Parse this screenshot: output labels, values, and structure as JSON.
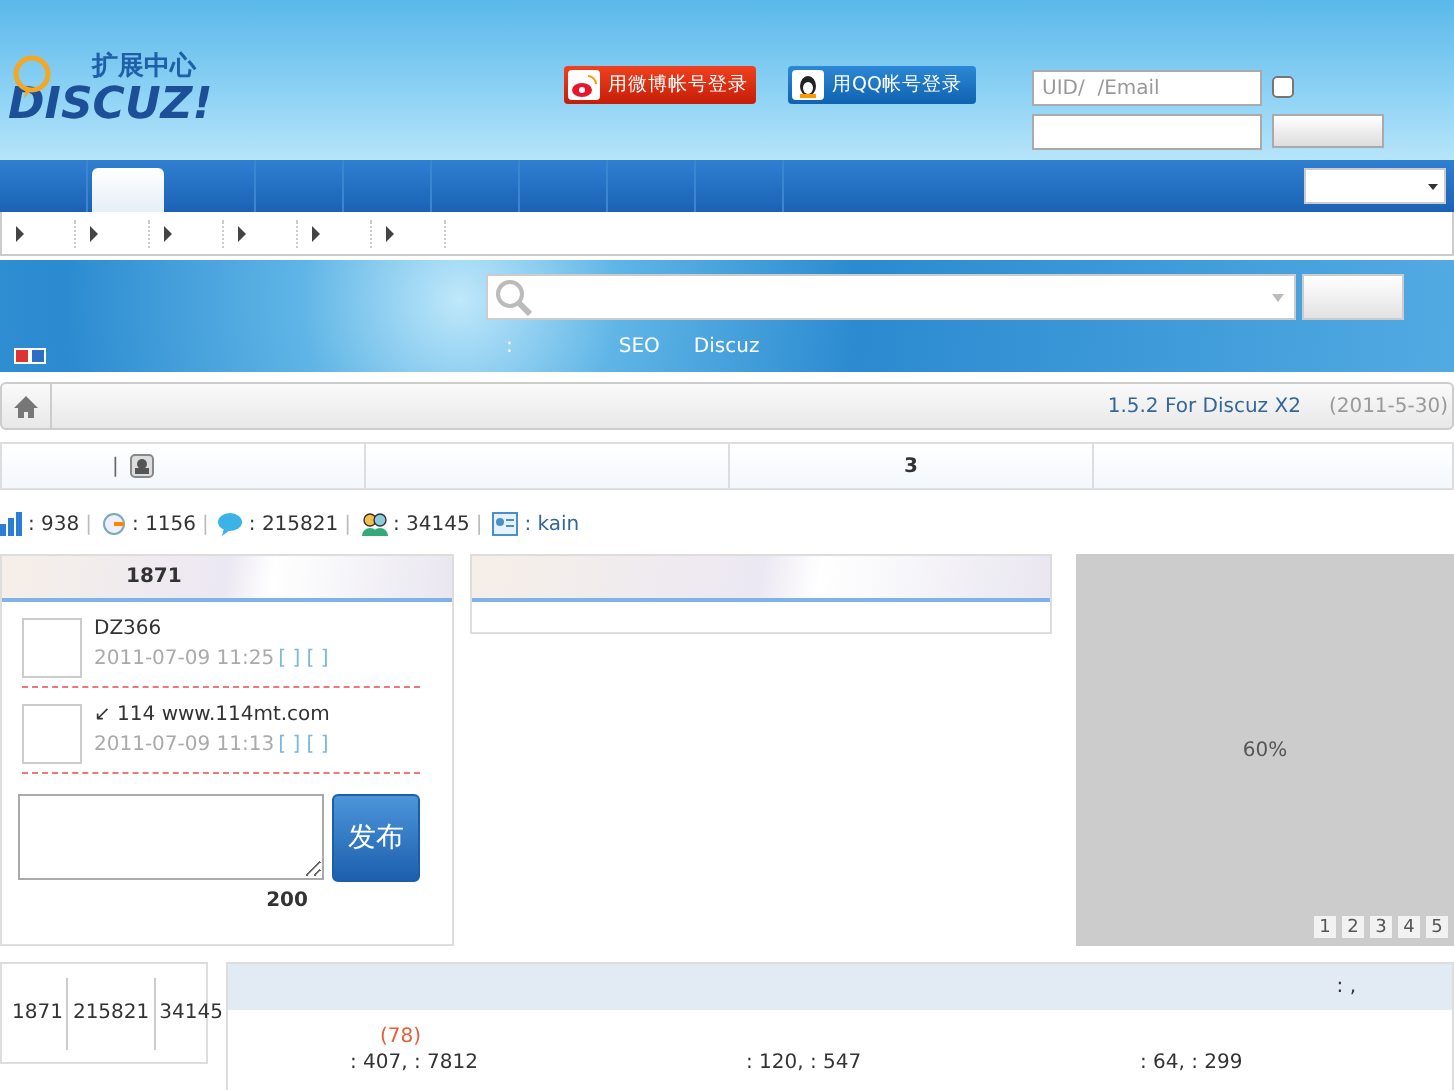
{
  "header": {
    "logo_caption": "扩展中心",
    "logo": "DISCUZ!",
    "social_logins": [
      {
        "kind": "weibo",
        "label": "用微博帐号登录"
      },
      {
        "kind": "qq",
        "label": "用QQ帐号登录"
      }
    ],
    "login": {
      "placeholder": "UID/  /Email",
      "remember_checked": false
    }
  },
  "nav": {
    "tabs": [
      {
        "selected": false
      },
      {
        "selected": true
      },
      {
        "selected": false
      },
      {
        "selected": false
      },
      {
        "selected": false
      },
      {
        "selected": false
      },
      {
        "selected": false
      },
      {
        "selected": false
      },
      {
        "selected": false
      }
    ]
  },
  "banner": {
    "links": [
      ":",
      "SEO",
      "Discuz"
    ]
  },
  "breadcrumb": {
    "version": "1.5.2 For Discuz X2",
    "date": "(2011-5-30)"
  },
  "info_bar": {
    "separator": "|",
    "count": "3"
  },
  "stats": {
    "separator": "|",
    "items": [
      {
        "kind": "chart",
        "value": ": 938"
      },
      {
        "kind": "new",
        "value": ": 1156"
      },
      {
        "kind": "comment",
        "value": ": 215821"
      },
      {
        "kind": "members",
        "value": ": 34145"
      },
      {
        "kind": "profile",
        "value": ": kain"
      }
    ]
  },
  "feed": {
    "title": "1871",
    "posts": [
      {
        "text": "DZ366",
        "time": "2011-07-09 11:25",
        "actions": "[ ] [ ]"
      },
      {
        "text": "↙   114    www.114mt.com",
        "time": "2011-07-09 11:13",
        "actions": "[ ] [ ]"
      }
    ],
    "publish": "发布",
    "limit": "200"
  },
  "slider": {
    "caption": "60%",
    "pages": [
      "1",
      "2",
      "3",
      "4",
      "5"
    ]
  },
  "totals": [
    "1871",
    "215821",
    "34145"
  ],
  "board": {
    "header": ":  ,",
    "count": "(78)",
    "rows": [
      ": 407,  : 7812",
      ": 120,  : 547",
      ": 64,  : 299"
    ]
  }
}
